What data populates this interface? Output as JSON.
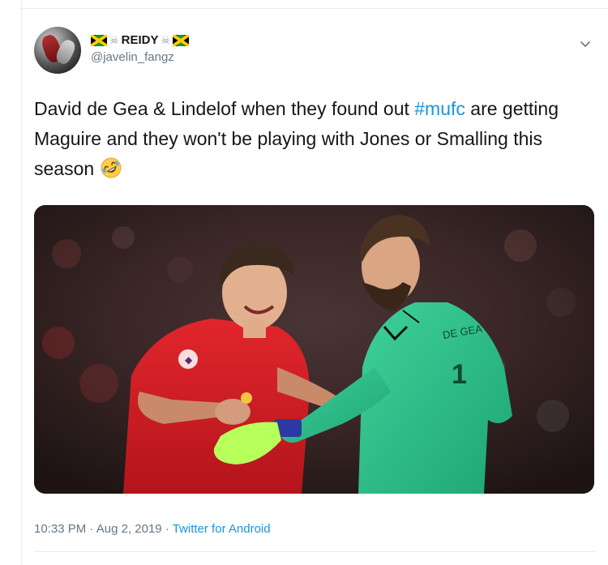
{
  "tweet": {
    "display_name": "REIDY",
    "handle": "@javelin_fangz",
    "text_before": "David de Gea & Lindelof when they found out ",
    "hashtag": "#mufc",
    "text_after": " are getting Maguire and they won't be playing with Jones or Smalling this season ",
    "emoji": "rolling-on-floor-laughing-icon",
    "media": {
      "jersey_left_text": "",
      "jersey_right_name": "DE GEA",
      "jersey_right_number": "1"
    },
    "time": "10:33 PM",
    "separator": "·",
    "date": "Aug 2, 2019",
    "source": "Twitter for Android"
  },
  "colors": {
    "link": "#1b95e0",
    "secondary_text": "#657786",
    "primary_text": "#14171a"
  }
}
